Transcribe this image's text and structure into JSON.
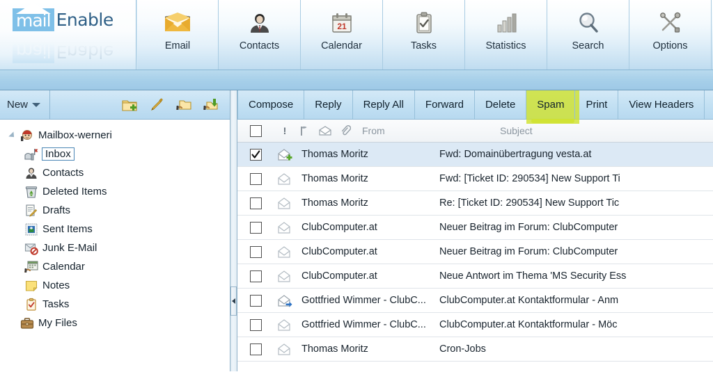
{
  "app": {
    "logo_mail": "mail",
    "logo_enable": "Enable"
  },
  "topnav": {
    "items": [
      {
        "label": "Email",
        "icon": "envelope-gold-icon",
        "active": true
      },
      {
        "label": "Contacts",
        "icon": "contact-person-icon",
        "active": false
      },
      {
        "label": "Calendar",
        "icon": "calendar-21-icon",
        "active": false
      },
      {
        "label": "Tasks",
        "icon": "clipboard-check-icon",
        "active": false
      },
      {
        "label": "Statistics",
        "icon": "bar-chart-icon",
        "active": false
      },
      {
        "label": "Search",
        "icon": "magnifier-icon",
        "active": false
      },
      {
        "label": "Options",
        "icon": "wrench-screwdriver-icon",
        "active": false
      }
    ]
  },
  "sidebar": {
    "new_button": "New",
    "tools": [
      {
        "name": "new-folder-icon"
      },
      {
        "name": "edit-pencil-icon"
      },
      {
        "name": "shared-folder-icon"
      },
      {
        "name": "folder-download-icon"
      }
    ],
    "tree": [
      {
        "label": "Mailbox-werneri",
        "icon": "mailbox-user-icon",
        "level": 0,
        "twisty": true,
        "selected": false
      },
      {
        "label": "Inbox",
        "icon": "inbox-flag-icon",
        "level": 1,
        "twisty": false,
        "selected": true
      },
      {
        "label": "Contacts",
        "icon": "contact-person-icon",
        "level": 1,
        "twisty": false,
        "selected": false
      },
      {
        "label": "Deleted Items",
        "icon": "trash-bin-icon",
        "level": 1,
        "twisty": false,
        "selected": false
      },
      {
        "label": "Drafts",
        "icon": "draft-pencil-icon",
        "level": 1,
        "twisty": false,
        "selected": false
      },
      {
        "label": "Sent Items",
        "icon": "sent-stamp-icon",
        "level": 1,
        "twisty": false,
        "selected": false
      },
      {
        "label": "Junk E-Mail",
        "icon": "junk-blocked-icon",
        "level": 1,
        "twisty": false,
        "selected": false
      },
      {
        "label": "Calendar",
        "icon": "calendar-folder-icon",
        "level": 1,
        "twisty": false,
        "selected": false
      },
      {
        "label": "Notes",
        "icon": "note-yellow-icon",
        "level": 1,
        "twisty": false,
        "selected": false
      },
      {
        "label": "Tasks",
        "icon": "task-clipboard-icon",
        "level": 1,
        "twisty": false,
        "selected": false
      },
      {
        "label": "My Files",
        "icon": "briefcase-icon",
        "level": 0,
        "twisty": false,
        "selected": false
      }
    ]
  },
  "message_toolbar": {
    "buttons": [
      {
        "label": "Compose",
        "highlighted": false
      },
      {
        "label": "Reply",
        "highlighted": false
      },
      {
        "label": "Reply All",
        "highlighted": false
      },
      {
        "label": "Forward",
        "highlighted": false
      },
      {
        "label": "Delete",
        "highlighted": false
      },
      {
        "label": "Spam",
        "highlighted": true
      },
      {
        "label": "Print",
        "highlighted": false
      },
      {
        "label": "View Headers",
        "highlighted": false
      }
    ],
    "highlight_color": "#cfe22e"
  },
  "list": {
    "columns": {
      "priority_icon": "exclamation-icon",
      "flag_icon": "flag-icon",
      "read_icon": "envelope-icon",
      "attachment_icon": "paperclip-icon",
      "from": "From",
      "subject": "Subject"
    },
    "rows": [
      {
        "checked": true,
        "icon": "envelope-add-icon",
        "from": "Thomas Moritz",
        "subject": "Fwd: Domainübertragung vesta.at",
        "selected": true
      },
      {
        "checked": false,
        "icon": "envelope-open-icon",
        "from": "Thomas Moritz",
        "subject": "Fwd: [Ticket ID: 290534] New Support Ti",
        "selected": false
      },
      {
        "checked": false,
        "icon": "envelope-open-icon",
        "from": "Thomas Moritz",
        "subject": "Re: [Ticket ID: 290534] New Support Tic",
        "selected": false
      },
      {
        "checked": false,
        "icon": "envelope-open-icon",
        "from": "ClubComputer.at",
        "subject": "Neuer Beitrag im Forum: ClubComputer",
        "selected": false
      },
      {
        "checked": false,
        "icon": "envelope-open-icon",
        "from": "ClubComputer.at",
        "subject": "Neuer Beitrag im Forum: ClubComputer",
        "selected": false
      },
      {
        "checked": false,
        "icon": "envelope-open-icon",
        "from": "ClubComputer.at",
        "subject": "Neue Antwort im Thema 'MS Security Ess",
        "selected": false
      },
      {
        "checked": false,
        "icon": "envelope-forward-icon",
        "from": "Gottfried Wimmer - ClubC...",
        "subject": "ClubComputer.at Kontaktformular - Anm",
        "selected": false
      },
      {
        "checked": false,
        "icon": "envelope-open-icon",
        "from": "Gottfried Wimmer - ClubC...",
        "subject": "ClubComputer.at Kontaktformular - Möc",
        "selected": false
      },
      {
        "checked": false,
        "icon": "envelope-open-icon",
        "from": "Thomas Moritz",
        "subject": "Cron-Jobs",
        "selected": false
      }
    ]
  }
}
